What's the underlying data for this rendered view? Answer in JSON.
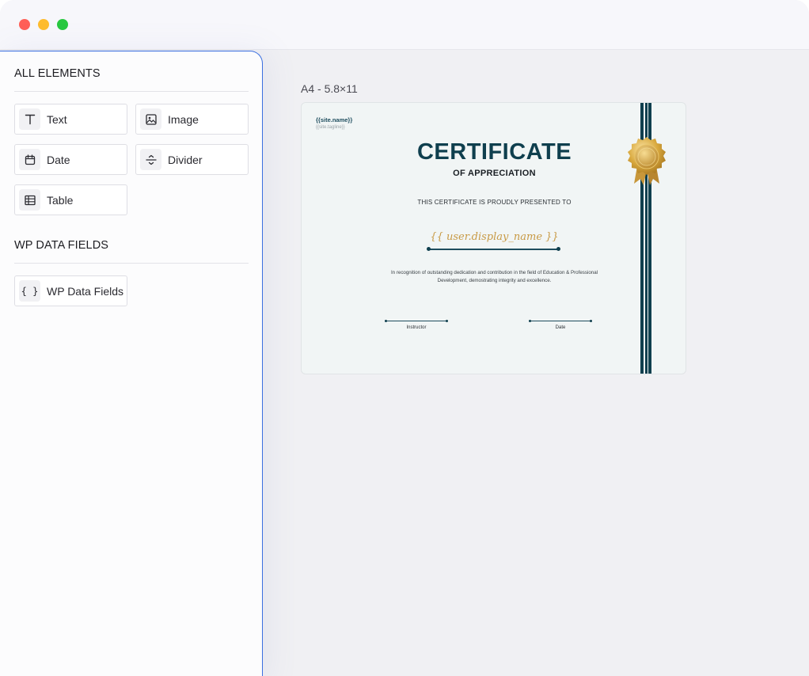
{
  "window": {
    "controls": [
      "close",
      "minimize",
      "maximize"
    ]
  },
  "sidebar": {
    "all_elements_title": "ALL ELEMENTS",
    "elements": [
      {
        "label": "Text",
        "icon": "text-icon"
      },
      {
        "label": "Image",
        "icon": "image-icon"
      },
      {
        "label": "Date",
        "icon": "calendar-icon"
      },
      {
        "label": "Divider",
        "icon": "divider-icon"
      },
      {
        "label": "Table",
        "icon": "table-icon"
      }
    ],
    "wp_data_title": "WP DATA FIELDS",
    "wp_fields": [
      {
        "label": "WP Data Fields",
        "icon": "braces-icon",
        "glyph": "{ }"
      }
    ]
  },
  "canvas": {
    "page_size": "A4 - 5.8×11"
  },
  "certificate": {
    "site_name": "{{site.name}}",
    "site_tagline": "{{site.tagline}}",
    "title": "CERTIFICATE",
    "subtitle": "OF APPRECIATION",
    "presented": "THIS CERTIFICATE IS PROUDLY PRESENTED TO",
    "recipient": "{{ user.display_name }}",
    "recognition": "In recognition of outstanding dedication and contribution in the field of Education & Professional Development, demostrating integrity and excellence.",
    "signature_labels": [
      "Instructor",
      "Date"
    ],
    "colors": {
      "primary": "#0f3f4e",
      "gold": "#c89a45",
      "accent_border": "#3b6fe0"
    }
  }
}
